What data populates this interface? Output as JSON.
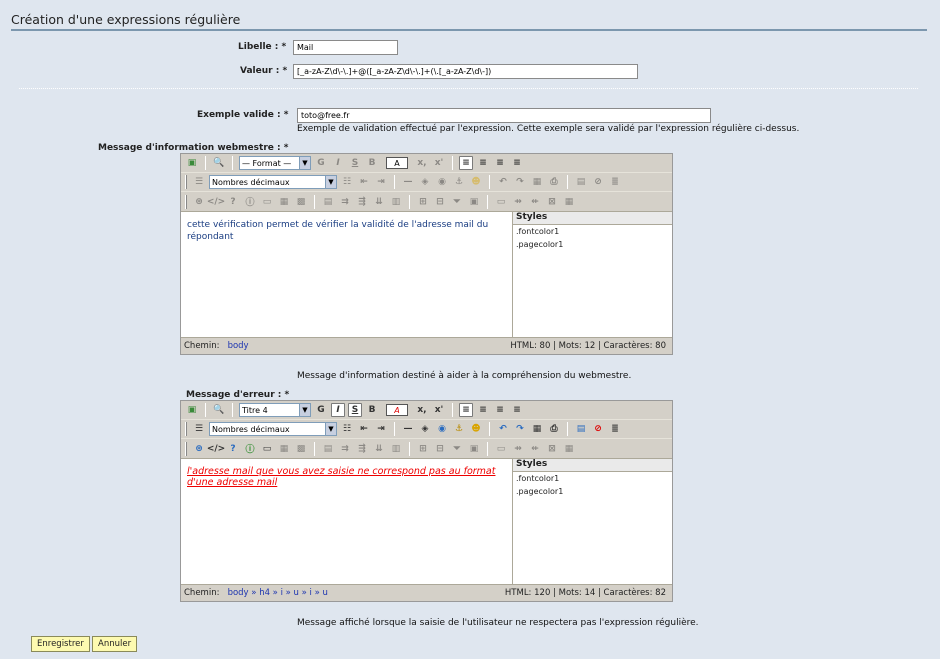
{
  "page": {
    "title": "Création d'une expressions régulière"
  },
  "form": {
    "libelle_label": "Libelle : *",
    "libelle_value": "Mail",
    "valeur_label": "Valeur : *",
    "valeur_value": "[_a-zA-Z\\d\\-\\.]+@([_a-zA-Z\\d\\-\\.]+(\\.[_a-zA-Z\\d\\-])",
    "exemple_label": "Exemple valide : *",
    "exemple_value": "toto@free.fr",
    "exemple_help": "Exemple de validation effectué par l'expression. Cette exemple sera validé par l'expression régulière ci-dessus.",
    "info_label": "Message d'information webmestre : *",
    "info_help": "Message d'information destiné à aider à la compréhension du webmestre.",
    "erreur_label": "Message d'erreur : *",
    "erreur_help": "Message affiché lorsque la saisie de l'utilisateur ne respectera pas l'expression régulière."
  },
  "editor1": {
    "format_select": "— Format —",
    "list_select": "Nombres décimaux",
    "content": "cette vérification permet de vérifier la validité de l'adresse mail du répondant",
    "styles_title": "Styles",
    "styles": [
      ".fontcolor1",
      ".pagecolor1"
    ],
    "path_label": "Chemin:",
    "path": "body",
    "stats": "HTML: 80 | Mots: 12 | Caractères: 80"
  },
  "editor2": {
    "format_select": "Titre 4",
    "list_select": "Nombres décimaux",
    "content": "l'adresse mail que vous avez saisie ne correspond pas au format d'une adresse mail",
    "styles_title": "Styles",
    "styles": [
      ".fontcolor1",
      ".pagecolor1"
    ],
    "path_label": "Chemin:",
    "path": "body » h4 » i » u » i » u",
    "stats": "HTML: 120 | Mots: 14 | Caractères: 82"
  },
  "buttons": {
    "save": "Enregistrer",
    "cancel": "Annuler"
  },
  "toolbar_glyphs": {
    "bold": "G",
    "italic": "I",
    "underline": "S",
    "strike": "B",
    "color": "A"
  },
  "colors": {
    "background": "#dfe6ef",
    "accent": "#7c97ae",
    "button": "#fdfab0",
    "error_text": "#e00000",
    "link": "#1d35b0"
  }
}
